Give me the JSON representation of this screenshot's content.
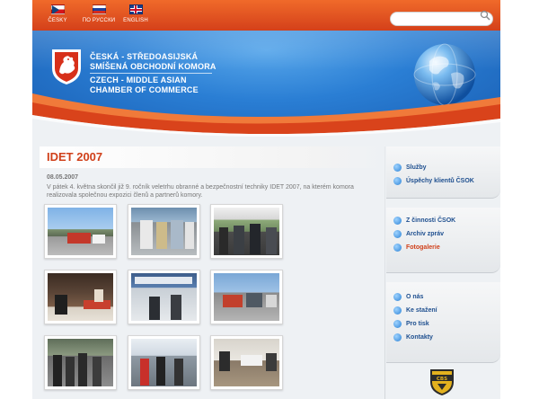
{
  "languages": [
    {
      "label": "ČESKY"
    },
    {
      "label": "ПО РУССКИ"
    },
    {
      "label": "ENGLISH"
    }
  ],
  "search": {
    "placeholder": ""
  },
  "header": {
    "line1": "ČESKÁ - STŘEDOASIJSKÁ",
    "line2": "SMÍŠENÁ OBCHODNÍ KOMORA",
    "line3": "CZECH - MIDDLE ASIAN",
    "line4": "CHAMBER OF COMMERCE"
  },
  "main": {
    "title": "IDET 2007",
    "date": "08.05.2007",
    "text": "V pátek 4. května skončil již 9. ročník veletrhu obranné a bezpečnostní techniky IDET 2007, na kterém komora realizovala společnou expozici členů a partnerů komory."
  },
  "sidebar": {
    "group1": [
      {
        "label": "Služby"
      },
      {
        "label": "Úspěchy klientů ČSOK"
      }
    ],
    "group2": [
      {
        "label": "Z činnosti ČSOK"
      },
      {
        "label": "Archiv zpráv"
      },
      {
        "label": "Fotogalerie"
      }
    ],
    "group3": [
      {
        "label": "O nás"
      },
      {
        "label": "Ke stažení"
      },
      {
        "label": "Pro tisk"
      },
      {
        "label": "Kontakty"
      }
    ],
    "active_item": "Fotogalerie"
  },
  "footer_logo": {
    "label": "CBS"
  },
  "colors": {
    "accent": "#d0401a",
    "header_blue": "#2a7ed4",
    "link": "#1e4f8f"
  }
}
